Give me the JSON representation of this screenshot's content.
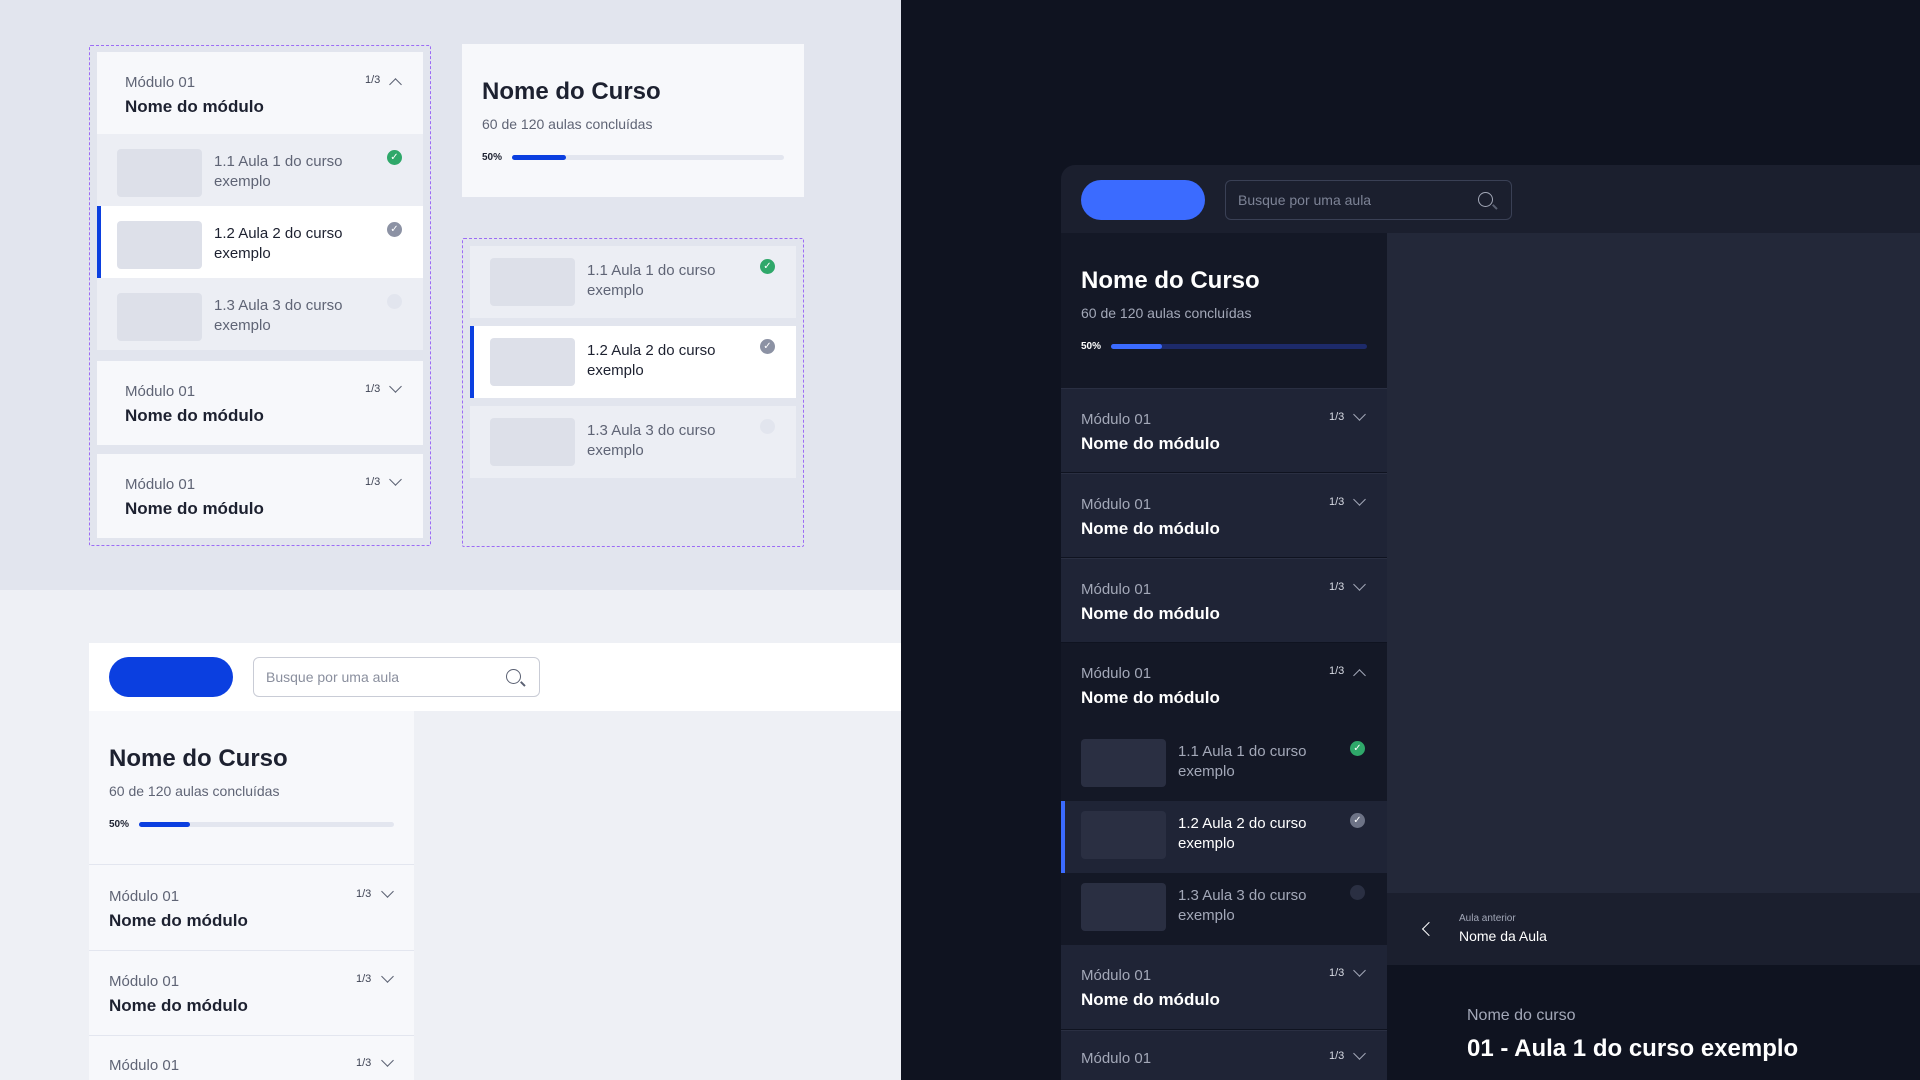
{
  "course": {
    "title": "Nome do Curso",
    "subtitle": "60 de 120 aulas concluídas",
    "progress_label": "50%",
    "progress": 0.5
  },
  "modules": [
    {
      "number": "Módulo 01",
      "name": "Nome do módulo",
      "count": "1/3"
    }
  ],
  "lessons": [
    {
      "title": "1.1 Aula 1 do curso exemplo",
      "status": "done",
      "icon": "check-circle-icon"
    },
    {
      "title": "1.2 Aula 2 do curso exemplo",
      "status": "viewing",
      "icon": "check-circle-icon"
    },
    {
      "title": "1.3 Aula 3 do curso exemplo",
      "status": "pending",
      "icon": "circle-icon"
    }
  ],
  "search": {
    "placeholder": "Busque por uma aula"
  },
  "navigation": {
    "prev_label": "Aula anterior",
    "prev_name": "Nome da Aula"
  },
  "player": {
    "course_name": "Nome do curso",
    "lesson_title": "01 - Aula 1 do curso exemplo"
  },
  "colors": {
    "accent": "#0b3fe0",
    "accent_dark": "#3b6bff",
    "success": "#2fa86a",
    "dashed_outline": "#9c6cf5",
    "dark_bg": "#0f1320"
  }
}
